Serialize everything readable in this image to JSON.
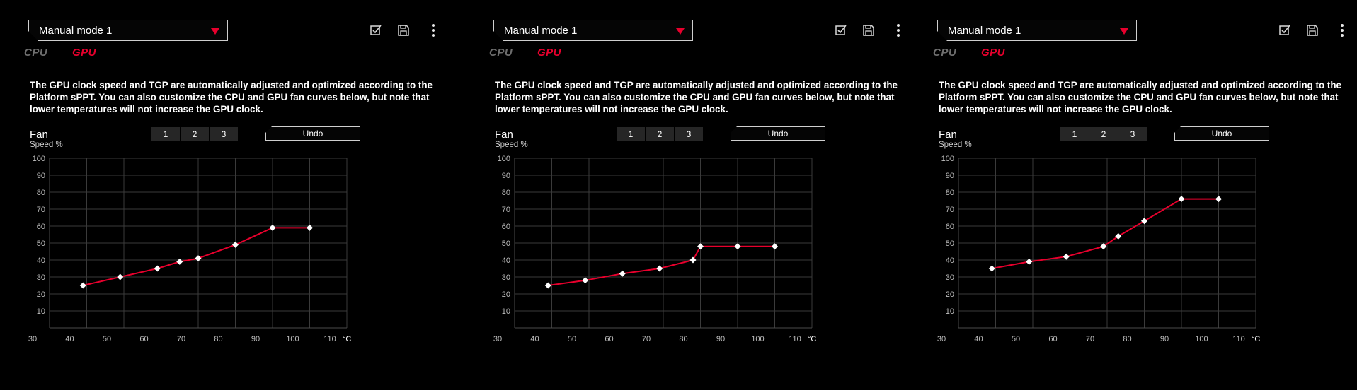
{
  "colors": {
    "accent": "#e8002d",
    "grid": "#3a3a3a",
    "point": "#ffffff",
    "inactive_tab": "#6e6e6e"
  },
  "panels": [
    {
      "mode_dropdown": {
        "value": "Manual mode 1",
        "arrow_icon": "triangle-down-icon"
      },
      "toolbar": {
        "apply_icon": "checkbox-icon",
        "save_icon": "save-icon",
        "more_icon": "more-vertical-icon"
      },
      "tabs": [
        {
          "label": "CPU",
          "active": false
        },
        {
          "label": "GPU",
          "active": true
        }
      ],
      "description": "The GPU clock speed and TGP are automatically adjusted and optimized according to the Platform sPPT. You can also customize the CPU and GPU fan curves below, but note that lower temperatures will not increase the GPU clock.",
      "fan": {
        "title": "Fan",
        "subtitle": "Speed %"
      },
      "fan_selector": [
        "1",
        "2",
        "3"
      ],
      "undo_label": "Undo",
      "chart_data": {
        "type": "line",
        "x_unit": "°C",
        "xlim": [
          30,
          110
        ],
        "ylim": [
          0,
          100
        ],
        "x_ticks": [
          30,
          40,
          50,
          60,
          70,
          80,
          90,
          100,
          110
        ],
        "y_ticks": [
          10,
          20,
          30,
          40,
          50,
          60,
          70,
          80,
          90,
          100
        ],
        "grid": true,
        "points": [
          [
            39,
            25
          ],
          [
            49,
            30
          ],
          [
            59,
            35
          ],
          [
            65,
            39
          ],
          [
            70,
            41
          ],
          [
            80,
            49
          ],
          [
            90,
            59
          ],
          [
            100,
            59
          ]
        ]
      }
    },
    {
      "mode_dropdown": {
        "value": "Manual mode 1",
        "arrow_icon": "triangle-down-icon"
      },
      "toolbar": {
        "apply_icon": "checkbox-icon",
        "save_icon": "save-icon",
        "more_icon": "more-vertical-icon"
      },
      "tabs": [
        {
          "label": "CPU",
          "active": false
        },
        {
          "label": "GPU",
          "active": true
        }
      ],
      "description": "The GPU clock speed and TGP are automatically adjusted and optimized according to the Platform sPPT. You can also customize the CPU and GPU fan curves below, but note that lower temperatures will not increase the GPU clock.",
      "fan": {
        "title": "Fan",
        "subtitle": "Speed %"
      },
      "fan_selector": [
        "1",
        "2",
        "3"
      ],
      "undo_label": "Undo",
      "chart_data": {
        "type": "line",
        "x_unit": "°C",
        "xlim": [
          30,
          110
        ],
        "ylim": [
          0,
          100
        ],
        "x_ticks": [
          30,
          40,
          50,
          60,
          70,
          80,
          90,
          100,
          110
        ],
        "y_ticks": [
          10,
          20,
          30,
          40,
          50,
          60,
          70,
          80,
          90,
          100
        ],
        "grid": true,
        "points": [
          [
            39,
            25
          ],
          [
            49,
            28
          ],
          [
            59,
            32
          ],
          [
            69,
            35
          ],
          [
            78,
            40
          ],
          [
            80,
            48
          ],
          [
            90,
            48
          ],
          [
            100,
            48
          ]
        ]
      }
    },
    {
      "mode_dropdown": {
        "value": "Manual mode 1",
        "arrow_icon": "triangle-down-icon"
      },
      "toolbar": {
        "apply_icon": "checkbox-icon",
        "save_icon": "save-icon",
        "more_icon": "more-vertical-icon"
      },
      "tabs": [
        {
          "label": "CPU",
          "active": false
        },
        {
          "label": "GPU",
          "active": true
        }
      ],
      "description": "The GPU clock speed and TGP are automatically adjusted and optimized according to the Platform sPPT. You can also customize the CPU and GPU fan curves below, but note that lower temperatures will not increase the GPU clock.",
      "fan": {
        "title": "Fan",
        "subtitle": "Speed %"
      },
      "fan_selector": [
        "1",
        "2",
        "3"
      ],
      "undo_label": "Undo",
      "chart_data": {
        "type": "line",
        "x_unit": "°C",
        "xlim": [
          30,
          110
        ],
        "ylim": [
          0,
          100
        ],
        "x_ticks": [
          30,
          40,
          50,
          60,
          70,
          80,
          90,
          100,
          110
        ],
        "y_ticks": [
          10,
          20,
          30,
          40,
          50,
          60,
          70,
          80,
          90,
          100
        ],
        "grid": true,
        "points": [
          [
            39,
            35
          ],
          [
            49,
            39
          ],
          [
            59,
            42
          ],
          [
            69,
            48
          ],
          [
            73,
            54
          ],
          [
            80,
            63
          ],
          [
            90,
            76
          ],
          [
            100,
            76
          ]
        ]
      }
    }
  ]
}
